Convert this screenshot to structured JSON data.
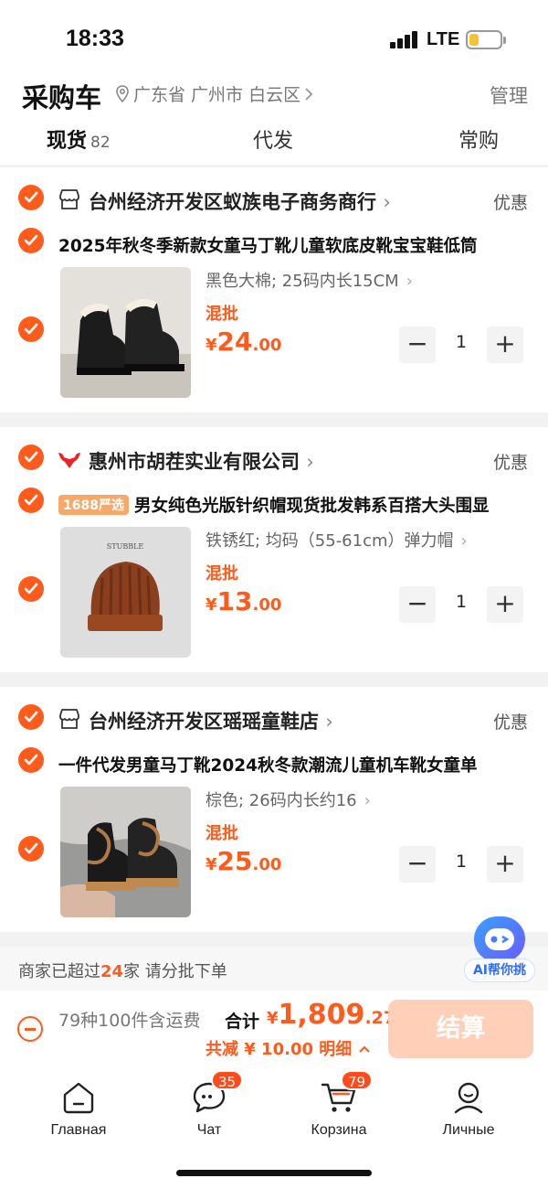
{
  "status": {
    "time": "18:33",
    "network": "LTE"
  },
  "header": {
    "title": "采购车",
    "location": "广东省 广州市 白云区",
    "manage": "管理"
  },
  "tabs": [
    {
      "label": "现货",
      "count": "82"
    },
    {
      "label": "代发"
    },
    {
      "label": "常购"
    }
  ],
  "shops": [
    {
      "name": "台州经济开发区蚁族电子商务商行",
      "promo": "优惠",
      "product": {
        "title": "2025年秋冬季新款女童马丁靴儿童软底皮靴宝宝鞋低筒",
        "spec": "黑色大棉; 25码内长15CM",
        "mixed": "混批",
        "currency": "¥",
        "price_int": "24",
        "price_dec": ".00",
        "qty": "1"
      }
    },
    {
      "name": "惠州市胡茬实业有限公司",
      "promo": "优惠",
      "product": {
        "badge": "1688严选",
        "title": "男女纯色光版针织帽现货批发韩系百搭大头围显",
        "spec": "铁锈红; 均码（55-61cm）弹力帽",
        "mixed": "混批",
        "currency": "¥",
        "price_int": "13",
        "price_dec": ".00",
        "qty": "1",
        "image_text": "STUBBLE"
      }
    },
    {
      "name": "台州经济开发区瑶瑶童鞋店",
      "promo": "优惠",
      "product": {
        "title": "一件代发男童马丁靴2024秋冬款潮流儿童机车靴女童单",
        "spec": "棕色; 26码内长约16",
        "mixed": "混批",
        "currency": "¥",
        "price_int": "25",
        "price_dec": ".00",
        "qty": "1"
      }
    }
  ],
  "notice": {
    "before": "商家已超过",
    "num": "24",
    "after": "家 请分批下单"
  },
  "ai": {
    "label": "AI帮你挑"
  },
  "summary": {
    "items": "79种100件含运费",
    "total_label": "合计",
    "currency": "¥",
    "total_int": "1,809",
    "total_dec": ".27",
    "discount": "共减 ¥ 10.00 明细",
    "checkout": "结算"
  },
  "nav": [
    {
      "label": "Главная",
      "icon": "home-icon"
    },
    {
      "label": "Чат",
      "icon": "chat-icon",
      "badge": "35"
    },
    {
      "label": "Корзина",
      "icon": "cart-icon",
      "badge": "79"
    },
    {
      "label": "Личные",
      "icon": "profile-icon"
    }
  ],
  "colors": {
    "accent": "#ff5b1c",
    "checkout_bg": "#ffcfb8",
    "ai_blue": "#2f6bff"
  }
}
